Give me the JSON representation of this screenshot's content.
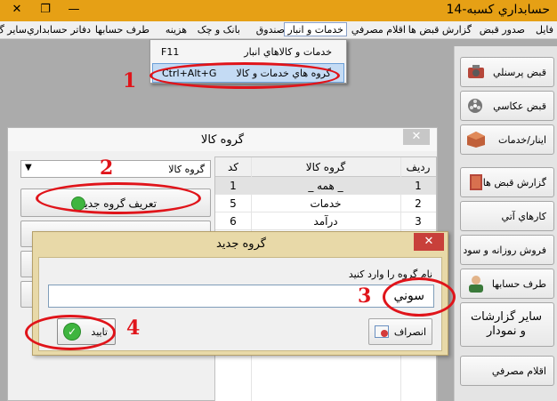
{
  "window": {
    "title": "حسابداري كسبه-14",
    "minimize_icon": "minimize-icon",
    "maximize_icon": "maximize-icon",
    "close_icon": "close-icon"
  },
  "menu": {
    "items": [
      "فايل",
      "صدور قبض",
      "گزارش قبض ها",
      "اقلام مصرفي",
      "خدمات و انبار",
      "صندوق",
      "بانک و چک",
      "هزينه",
      "طرف حسابها",
      "دفاتر حسابداري",
      "ساير گ"
    ]
  },
  "dropdown": {
    "items": [
      {
        "label": "خدمات و كالاهاي انبار",
        "shortcut": "F11"
      },
      {
        "label": "گروه هاي خدمات و كالا",
        "shortcut": "Ctrl+Alt+G"
      }
    ]
  },
  "right_panel": {
    "buttons": [
      {
        "label": "قبض پرسنلي",
        "icon": "camera-icon"
      },
      {
        "label": "قبض عكاسي",
        "icon": "film-reel-icon"
      },
      {
        "label": "اينار/خدمات",
        "icon": "box-icon"
      },
      {
        "label": "گزارش قبض ها",
        "icon": "book-icon"
      },
      {
        "label": "كارهاي آتي",
        "icon": ""
      },
      {
        "label": "فروش روزانه و سود",
        "icon": ""
      },
      {
        "label": "طرف حسابها",
        "icon": "user-icon"
      },
      {
        "label": "ساير گزارشات و نمودار",
        "icon": ""
      },
      {
        "label": "اقلام مصرفي",
        "icon": ""
      }
    ]
  },
  "kala_window": {
    "title": "گروه كالا",
    "combo_value": "گروه كالا",
    "define_button": "تعريف گروه جديد",
    "table": {
      "headers": {
        "row": "رديف",
        "name": "گروه كالا",
        "code": "كد"
      },
      "rows": [
        {
          "row": "1",
          "name": "_ همه _",
          "code": "1"
        },
        {
          "row": "2",
          "name": "خدمات",
          "code": "5"
        },
        {
          "row": "3",
          "name": "درآمد",
          "code": "6"
        }
      ]
    }
  },
  "new_group_dialog": {
    "title": "گروه جديد",
    "prompt": "نام گروه را وارد كنيد",
    "input_value": "سوني",
    "cancel_label": "انصراف",
    "confirm_label": "تاييد"
  },
  "annotations": [
    "1",
    "2",
    "3",
    "4"
  ],
  "colors": {
    "titlebar": "#e6a015",
    "annotation": "#e0141a",
    "dialog_frame": "#e8d9a8"
  }
}
